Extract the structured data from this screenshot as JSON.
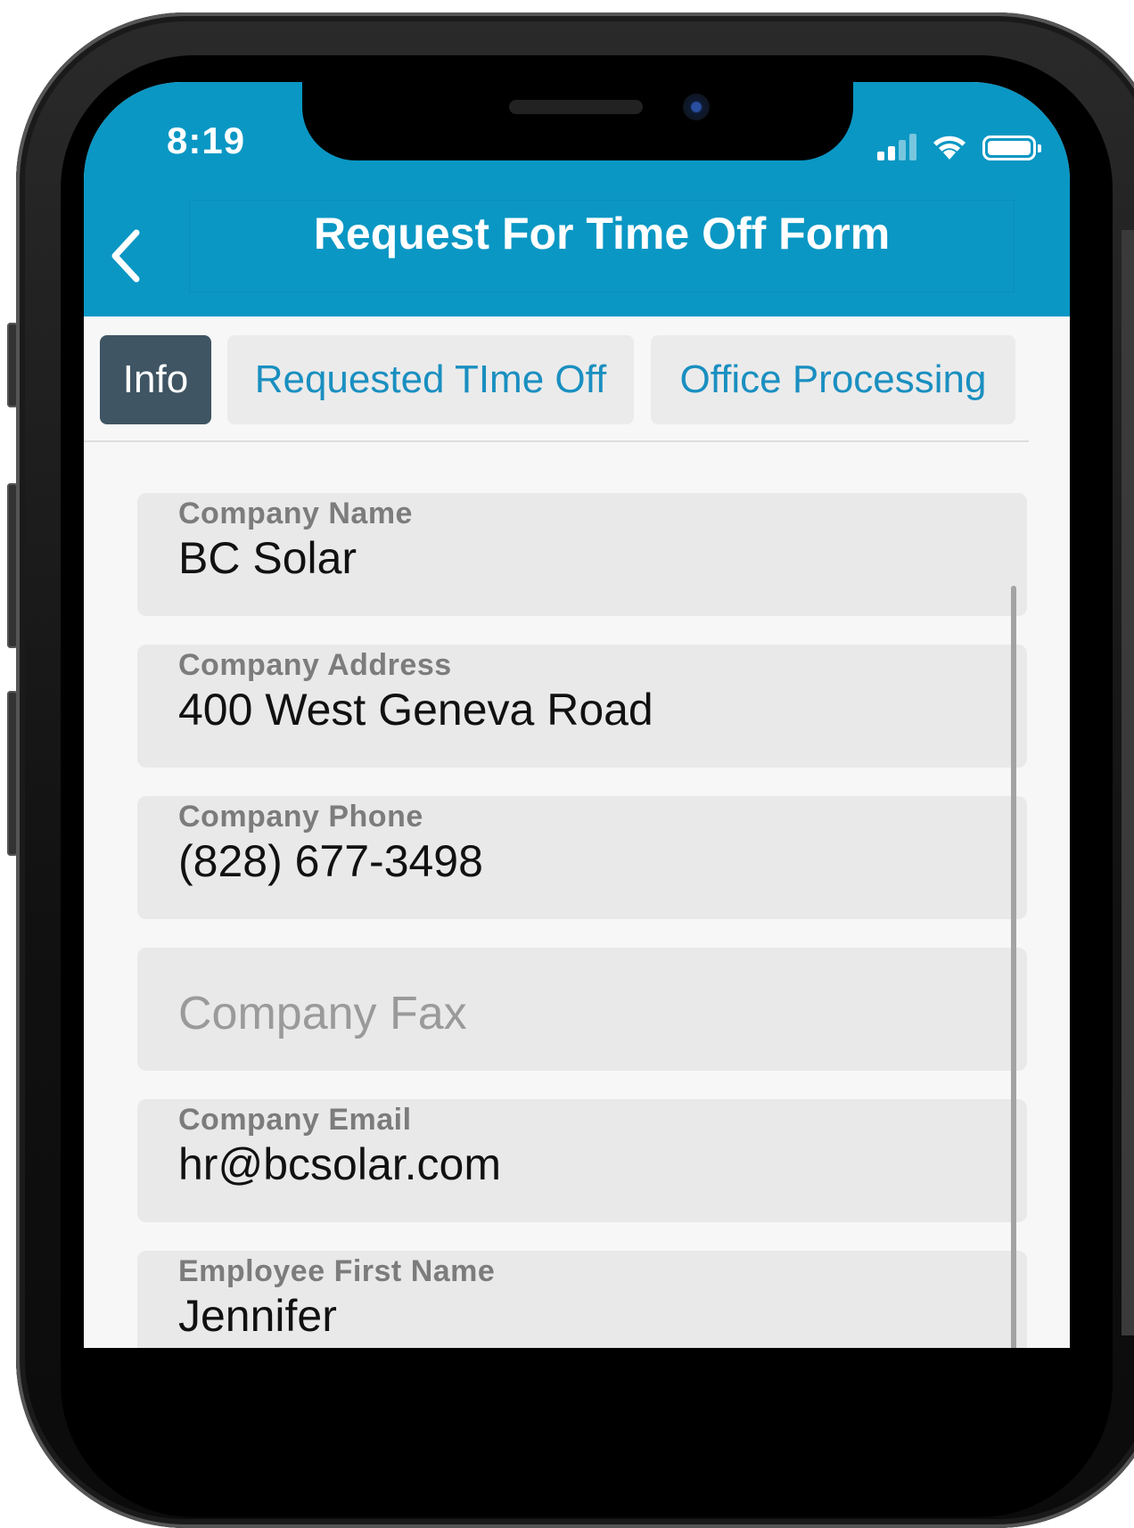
{
  "status_bar": {
    "time": "8:19",
    "icons": [
      "signal-icon",
      "wifi-icon",
      "battery-icon"
    ]
  },
  "header": {
    "title": "Request For Time Off Form",
    "back_icon": "chevron-left-icon"
  },
  "tabs": [
    {
      "label": "Info",
      "active": true
    },
    {
      "label": "Requested TIme Off",
      "active": false
    },
    {
      "label": "Office Processing",
      "active": false
    }
  ],
  "form": {
    "fields": [
      {
        "label": "Company Name",
        "value": "BC Solar"
      },
      {
        "label": "Company Address",
        "value": "400 West Geneva Road"
      },
      {
        "label": "Company Phone",
        "value": "(828) 677-3498"
      },
      {
        "placeholder": "Company Fax"
      },
      {
        "label": "Company Email",
        "value": "hr@bcsolar.com"
      },
      {
        "label": "Employee First Name",
        "value": "Jennifer"
      }
    ]
  },
  "colors": {
    "header_bg": "#0a97c4",
    "active_tab_bg": "#3f5563",
    "tab_text": "#1a8fc0",
    "field_bg": "#e9e9e9"
  }
}
